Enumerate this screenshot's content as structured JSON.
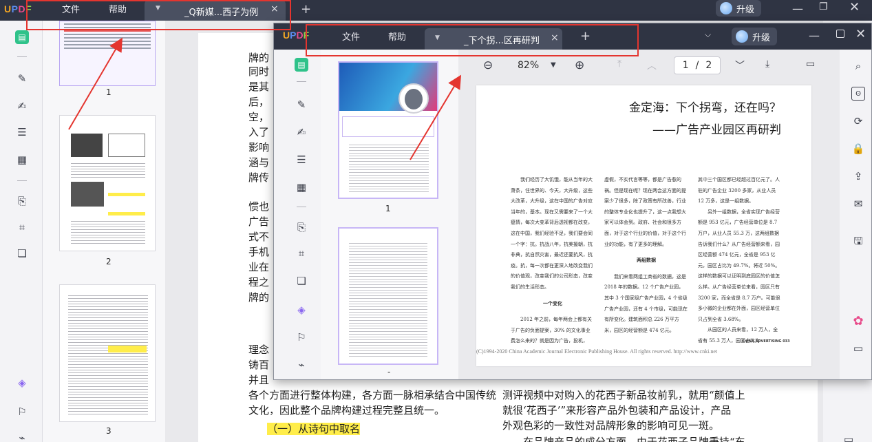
{
  "colors": {
    "titlebar_bg": "#2f3443",
    "active_tab_bg": "#4a5061",
    "accent_purple": "#8a67f0",
    "highlight_yellow": "#ffed4a",
    "annotation_red": "#e4352f",
    "logo_colors": [
      "#f5a623",
      "#5b8def",
      "#e84c8b",
      "#8ad24c"
    ]
  },
  "back_window": {
    "logo": "UPDF",
    "menu": {
      "file": "文件",
      "help": "帮助"
    },
    "tab_title": "_Q新媒...西子为例",
    "tab_close": "×",
    "add_tab": "+",
    "upgrade_label": "升级",
    "window_controls": {
      "minimize": "—",
      "maximize": "❐",
      "close": "✕"
    },
    "thumbnail_numbers": [
      "1",
      "2",
      "3"
    ],
    "document_lines": [
      "牌的",
      "同时",
      "是其",
      "后，",
      "空，",
      "入了",
      "影响",
      "涵与",
      "牌传",
      "惯也",
      "广告",
      "式不",
      "手机",
      "业在",
      "程之",
      "牌的",
      "理念",
      "铸百",
      "并且",
      "各个方面进行整体构建，各方面一脉相承结合中国传统",
      "文化，因此整个品牌构建过程完整且统一。",
      "（一）从诗句中取名"
    ],
    "document_right_lines": [
      "测评视频中对购入的花西子新品妆前乳，就用“颜值上",
      "就很‘花西子’”来形容产品外包装和产品设计，产品",
      "外观色彩的一致性对品牌形象的影响可见一斑。",
      "在品牌产品的成分方面，由于花西子品牌秉持“东"
    ]
  },
  "front_window": {
    "logo": "UPDF",
    "menu": {
      "file": "文件",
      "help": "帮助"
    },
    "tab_title": "_下个拐...区再研判",
    "tab_close": "×",
    "add_tab": "+",
    "upgrade_label": "升级",
    "window_controls": {
      "minimize": "—",
      "close": "✕"
    },
    "thumbnail_numbers": [
      "1",
      "-"
    ],
    "toolbar": {
      "zoom_out": "⊖",
      "zoom_level": "82%",
      "zoom_in": "⊕",
      "current_page": "1",
      "page_sep": "/",
      "total_pages": "2"
    },
    "page": {
      "title": "金定海：下个拐弯，还在吗？",
      "subtitle": "——广告产业园区再研判",
      "col1_para1": "我们经历了大饥饿，能从当年的大萧条，住世界的、今天，大升级，这些大改革，大升级，这在中国的广告对应当年的，基本。现在又需要来了一个大瘟情，每次大变革背后透视都在改变，这在中国，我们经验不足，我们要会同一个字：抗。抗战八年，抗美援朝，抗非典，抗自然灾害，最近还要抗风，抗疫。抗，每一次都在更深入地改变我们的价值观，改变我们的公司形态，改变我们的生活形态。",
      "col1_heading": "一个变化",
      "col1_para2": "2012 年之前，每年两会上都有关于广告的负面提案，30% 的文化事业费怎么来的？就是因为广告，投机，",
      "col2_para1": "虚假，不实代言等等，都是广告惹的祸。但是现在呢？现在两会这方面的提案少了很多，除了政策有所改善，行业的整体专业化也提升了，这一点我想大家可以体会到。政府、社会和很多方面，对于这个行业的价值，对于这个行业的功能，有了更多的理解。",
      "col2_heading": "两组数据",
      "col2_para2": "我们来看两组工商省的数据，这是 2018 年的数据。12 个广告产业园，其中 3 个国家级广告产业园，4 个省级广告产业园，还有 4 个市级，可能现在有所变化。建筑面积总 226 万平方米，园区的经营额是 474 亿元。",
      "col3_para1": "其中三个国区都已经超过百亿元了。人驻的广告企业 3200 多家，从业人员 12 万多，这是一组数据。",
      "col3_para2": "另外一组数据，全省实现广告经营额是 953 亿元，广告经营单位是 8.7 万户，从业人员 55.3 万，这两组数据告诉我们什么？从广告经营额来看，园区经营额 474 亿元，全省是 953 亿元，园区占比为 49.7%。将近 50%。这样的数据可以证明到底园区的价值怎么样。从广告经营单位来看，园区只有 3200 家，而全省是 8.7 万户。可能很多小微的企业都在外面，园区经营单位只占到全省 3.68%。",
      "col3_para3": "从园区的人员来看，12 万人，全省有 55.3 万人，园区占比为",
      "footer": "(C)1994-2020 China Academic Journal Electronic Publishing House. All rights reserved.    http://www.cnki.net",
      "journal": "CHINA ADVERTISING  033"
    }
  }
}
